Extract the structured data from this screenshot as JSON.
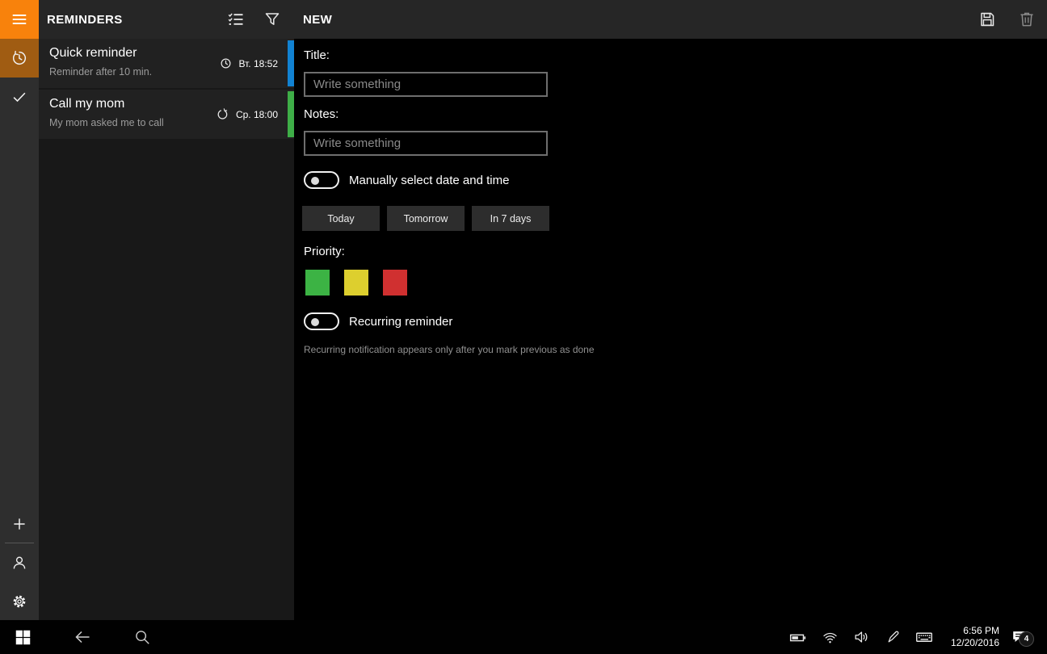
{
  "header": {
    "app_title": "REMINDERS",
    "page_title": "NEW"
  },
  "list": {
    "items": [
      {
        "title": "Quick reminder",
        "subtitle": "Reminder after 10 min.",
        "time": "Вт. 18:52",
        "accent_color": "#1182d2"
      },
      {
        "title": "Call my mom",
        "subtitle": "My mom asked me to call",
        "time": "Ср. 18:00",
        "accent_color": "#3eae47"
      }
    ]
  },
  "form": {
    "title_label": "Title:",
    "title_placeholder": "Write something",
    "notes_label": "Notes:",
    "notes_placeholder": "Write something",
    "manual_datetime_label": "Manually select date and time",
    "quick_date_buttons": [
      "Today",
      "Tomorrow",
      "In 7 days"
    ],
    "priority_label": "Priority:",
    "priority_colors": [
      "#3cb344",
      "#ddcf2e",
      "#d03030"
    ],
    "recurring_label": "Recurring reminder",
    "recurring_note": "Recurring notification appears only after you mark previous as done"
  },
  "taskbar": {
    "time": "6:56 PM",
    "date": "12/20/2016",
    "notification_badge": "4"
  }
}
